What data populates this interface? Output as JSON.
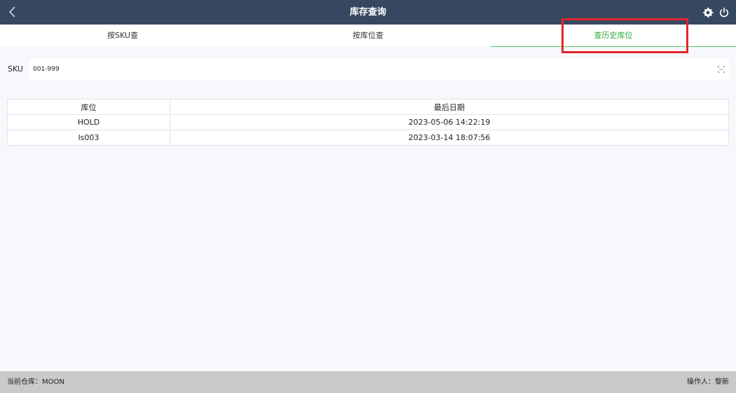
{
  "header": {
    "title": "库存查询",
    "back_icon": "chevron-left-icon",
    "settings_icon": "gear-icon",
    "power_icon": "power-icon"
  },
  "tabs": [
    {
      "label": "按SKU查",
      "active": false
    },
    {
      "label": "按库位查",
      "active": false
    },
    {
      "label": "查历史库位",
      "active": true
    }
  ],
  "sku": {
    "label": "SKU",
    "value": "001-999",
    "scan_icon": "scan-icon"
  },
  "table": {
    "columns": [
      "库位",
      "最后日期"
    ],
    "rows": [
      {
        "location": "HOLD",
        "last_date": "2023-05-06 14:22:19"
      },
      {
        "location": "ls003",
        "last_date": "2023-03-14 18:07:56"
      }
    ]
  },
  "footer": {
    "warehouse_label": "当前仓库：",
    "warehouse_value": "MOON",
    "operator_label": "操作人：",
    "operator_value": "黎新"
  },
  "colors": {
    "header_bg": "#364860",
    "active_tab": "#2ea832",
    "highlight": "#e3262b",
    "footer_bg": "#c9c9c9"
  }
}
